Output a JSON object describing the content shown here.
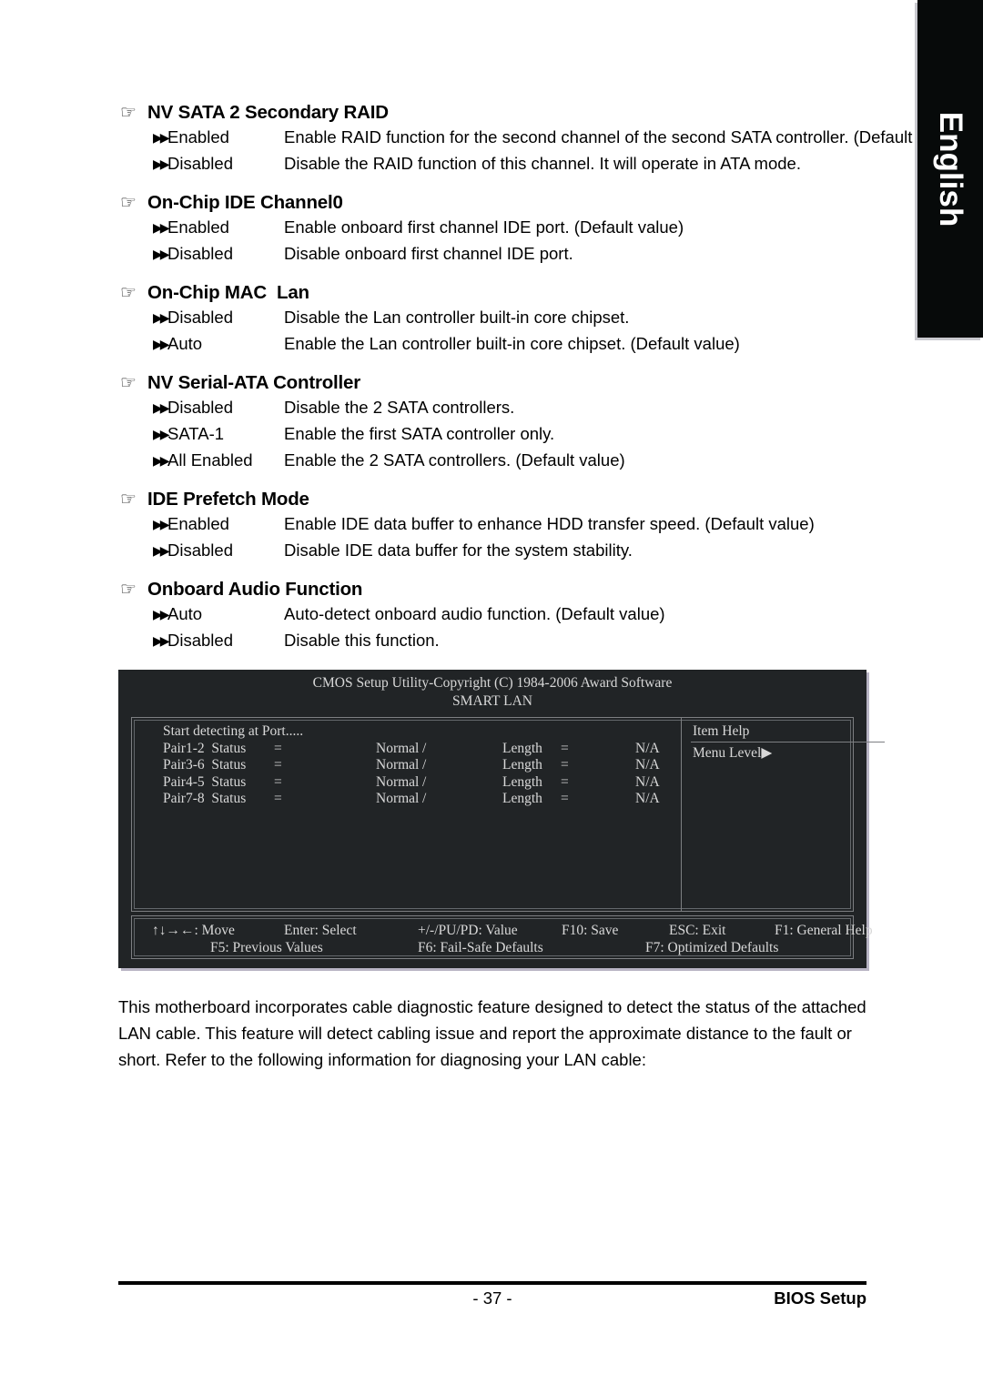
{
  "language_tab": {
    "label": "English"
  },
  "icons": {
    "hand": "☞",
    "double_arrow": "▶▶",
    "menu_level_arrow": "▶"
  },
  "sections": [
    {
      "title": "NV SATA 2 Secondary RAID",
      "options": [
        {
          "name": "Enabled",
          "desc": "Enable RAID function for the second channel of the second SATA controller. (Default value)"
        },
        {
          "name": "Disabled",
          "desc": "Disable the RAID function of this channel. It will operate in ATA mode."
        }
      ]
    },
    {
      "title": "On-Chip IDE Channel0",
      "options": [
        {
          "name": "Enabled",
          "desc": "Enable onboard first channel IDE port. (Default value)"
        },
        {
          "name": "Disabled",
          "desc": "Disable onboard first channel IDE port."
        }
      ]
    },
    {
      "title": "On-Chip MAC  Lan",
      "options": [
        {
          "name": "Disabled",
          "desc": "Disable the Lan controller built-in core chipset."
        },
        {
          "name": "Auto",
          "desc": "Enable the Lan controller built-in core chipset. (Default value)"
        }
      ]
    },
    {
      "title": "NV Serial-ATA Controller",
      "options": [
        {
          "name": "Disabled",
          "desc": "Disable the 2 SATA controllers."
        },
        {
          "name": "SATA-1",
          "desc": "Enable the first SATA controller only."
        },
        {
          "name": "All Enabled",
          "desc": "Enable the 2 SATA controllers. (Default value)"
        }
      ]
    },
    {
      "title": "IDE Prefetch Mode",
      "options": [
        {
          "name": "Enabled",
          "desc": "Enable IDE data buffer to enhance HDD transfer speed. (Default value)"
        },
        {
          "name": "Disabled",
          "desc": "Disable IDE data buffer for the system stability."
        }
      ]
    },
    {
      "title": "Onboard Audio Function",
      "options": [
        {
          "name": "Auto",
          "desc": "Auto-detect onboard audio function. (Default value)"
        },
        {
          "name": "Disabled",
          "desc": "Disable this function."
        }
      ]
    },
    {
      "title": "SMART  LAN",
      "options": []
    }
  ],
  "bios_screen": {
    "title_line1": "CMOS Setup Utility-Copyright (C) 1984-2006 Award Software",
    "title_line2": "SMART LAN",
    "detect_line": "Start detecting at Port.....",
    "rows": [
      {
        "label": "Pair1-2  Status",
        "eq1": "=",
        "status": "Normal",
        "slash": "/",
        "length": "Length",
        "eq2": "=",
        "value": "N/A"
      },
      {
        "label": "Pair3-6  Status",
        "eq1": "=",
        "status": "Normal",
        "slash": "/",
        "length": "Length",
        "eq2": "=",
        "value": "N/A"
      },
      {
        "label": "Pair4-5  Status",
        "eq1": "=",
        "status": "Normal",
        "slash": "/",
        "length": "Length",
        "eq2": "=",
        "value": "N/A"
      },
      {
        "label": "Pair7-8  Status",
        "eq1": "=",
        "status": "Normal",
        "slash": "/",
        "length": "Length",
        "eq2": "=",
        "value": "N/A"
      }
    ],
    "help": {
      "title": "Item Help",
      "menu_level": "Menu Level"
    },
    "keys_row1": [
      "↑↓→←: Move",
      "Enter: Select",
      "+/-/PU/PD: Value",
      "F10: Save",
      "ESC: Exit",
      "F1: General Help"
    ],
    "keys_row2": [
      "F5: Previous Values",
      "F6: Fail-Safe Defaults",
      "F7: Optimized Defaults"
    ]
  },
  "body_text": "This motherboard incorporates cable diagnostic feature designed to detect the status of the attached LAN cable.  This feature will detect cabling issue and report the approximate distance to the fault or short. Refer to the following information for diagnosing your LAN cable:",
  "footer": {
    "page_number": "- 37 -",
    "right_label": "BIOS Setup"
  }
}
